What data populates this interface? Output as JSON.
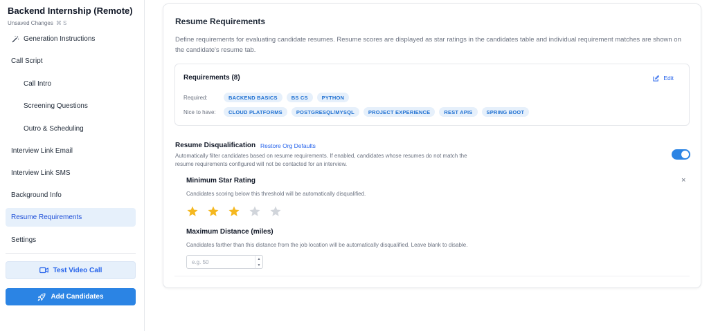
{
  "sidebar": {
    "title": "Backend Internship (Remote)",
    "unsaved": "Unsaved Changes",
    "shortcut": "⌘ S",
    "items": [
      {
        "label": "Generation Instructions",
        "icon": "magic-wand-icon"
      },
      {
        "label": "Call Script"
      },
      {
        "label": "Call Intro"
      },
      {
        "label": "Screening Questions"
      },
      {
        "label": "Outro & Scheduling"
      },
      {
        "label": "Interview Link Email"
      },
      {
        "label": "Interview Link SMS"
      },
      {
        "label": "Background Info"
      },
      {
        "label": "Resume Requirements",
        "active": true
      },
      {
        "label": "Settings"
      }
    ],
    "test_video_call": "Test Video Call",
    "add_candidates": "Add Candidates"
  },
  "main": {
    "title": "Resume Requirements",
    "description": "Define requirements for evaluating candidate resumes. Resume scores are displayed as star ratings in the candidates table and individual requirement matches are shown on the candidate's resume tab.",
    "requirements": {
      "title": "Requirements (8)",
      "edit_label": "Edit",
      "required_label": "Required:",
      "required": [
        "BACKEND BASICS",
        "BS CS",
        "PYTHON"
      ],
      "nice_label": "Nice to have:",
      "nice": [
        "CLOUD PLATFORMS",
        "POSTGRESQL/MYSQL",
        "PROJECT EXPERIENCE",
        "REST APIS",
        "SPRING BOOT"
      ]
    },
    "disqualification": {
      "title": "Resume Disqualification",
      "restore_label": "Restore Org Defaults",
      "description": "Automatically filter candidates based on resume requirements. If enabled, candidates whose resumes do not match the resume requirements configured will not be contacted for an interview.",
      "enabled": true
    },
    "min_star": {
      "title": "Minimum Star Rating",
      "close_glyph": "×",
      "description": "Candidates scoring below this threshold will be automatically disqualified.",
      "rating": 3,
      "max": 5
    },
    "max_distance": {
      "title": "Maximum Distance (miles)",
      "description": "Candidates farther than this distance from the job location will be automatically disqualified. Leave blank to disable.",
      "placeholder": "e.g. 50",
      "value": ""
    }
  },
  "colors": {
    "accent": "#2b84e4",
    "star_filled": "#f5b820",
    "star_empty": "#d1d5db",
    "chip_bg": "#e6f0fb",
    "active_bg": "#e6f0fb"
  }
}
